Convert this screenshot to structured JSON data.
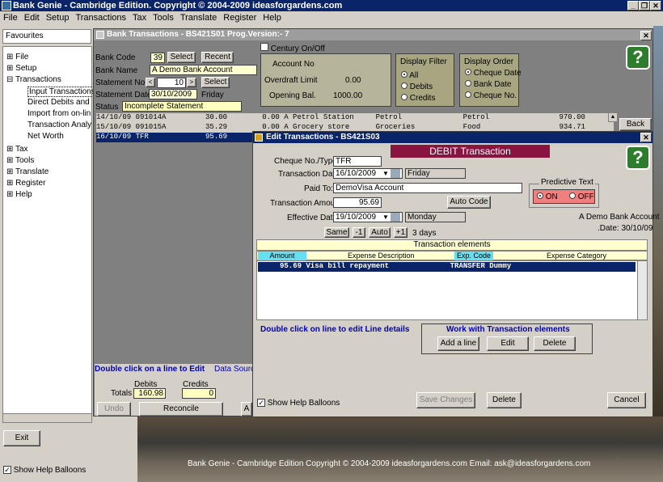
{
  "app": {
    "title": "Bank Genie  - Cambridge Edition. Copyright © 2004-2009 ideasforgardens.com",
    "menu": [
      "File",
      "Edit",
      "Setup",
      "Transactions",
      "Tax",
      "Tools",
      "Translate",
      "Register",
      "Help"
    ],
    "footer": "Bank Genie - Cambridge Edition     Copyright © 2004-2009 ideasforgardens.com     Email:  ask@ideasforgardens.com"
  },
  "left": {
    "favourites": "Favourites",
    "tree": [
      {
        "label": "File",
        "kind": "plus"
      },
      {
        "label": "Setup",
        "kind": "plus"
      },
      {
        "label": "Transactions",
        "kind": "minus"
      },
      {
        "label": "Input Transactions",
        "kind": "child"
      },
      {
        "label": "Direct Debits and",
        "kind": "child"
      },
      {
        "label": "Import from on-lin",
        "kind": "child"
      },
      {
        "label": "Transaction Analy",
        "kind": "child"
      },
      {
        "label": "Net Worth",
        "kind": "child"
      },
      {
        "label": "Tax",
        "kind": "plus"
      },
      {
        "label": "Tools",
        "kind": "plus"
      },
      {
        "label": "Translate",
        "kind": "plus"
      },
      {
        "label": "Register",
        "kind": "plus"
      },
      {
        "label": "Help",
        "kind": "plus"
      }
    ],
    "exit": "Exit",
    "show_help": "Show Help Balloons"
  },
  "bt": {
    "title": "Bank Transactions - BS421S01   Prog.Version:-  7",
    "century": "Century On/Off",
    "bank_code_label": "Bank Code",
    "bank_code": "39",
    "select": "Select",
    "recent": "Recent",
    "bank_name_label": "Bank Name",
    "bank_name": "A Demo Bank Account",
    "stmt_no_label": "Statement No",
    "stmt_no": "10",
    "stmt_select": "Select",
    "stmt_date_label": "Statement Date",
    "stmt_date": "30/10/2009",
    "stmt_day": "Friday",
    "status_label": "Status",
    "status": "Incomplete Statement",
    "account_no": "Account No",
    "overdraft_label": "Overdraft Limit",
    "overdraft": "0.00",
    "opening_label": "Opening Bal.",
    "opening": "1000.00",
    "filter_title": "Display Filter",
    "filter": [
      "All",
      "Debits",
      "Credits"
    ],
    "order_title": "Display Order",
    "order": [
      "Cheque Date",
      "Bank Date",
      "Cheque No."
    ],
    "rows": [
      "14/10/09 091014A         30.00        0.00 A Petrol Station     Petrol              Petrol                970.00",
      "15/10/09 091015A         35.29        0.00 A Grocery store      Groceries           Food                  934.71",
      "16/10/09 TFR             95.69"
    ],
    "back": "Back",
    "dbl_click": "Double click on a line to Edit",
    "data_source": "Data Source",
    "debits_label": "Debits",
    "credits_label": "Credits",
    "totals_label": "Totals",
    "debits": "160.98",
    "credits": "0",
    "undo": "Undo",
    "reconcile": "Reconcile",
    "a_btn": "A"
  },
  "et": {
    "title": "Edit Transactions - BS421S03",
    "banner": "DEBIT Transaction",
    "cheque_label": "Cheque No./Type",
    "cheque": "TFR",
    "tdate_label": "Transaction Date",
    "tdate": "16/10/2009",
    "tday": "Friday",
    "paid_label": "Paid To:",
    "paid": "DemoVisa Account",
    "amount_label": "Transaction Amount",
    "amount": "95.69",
    "auto_code": "Auto Code",
    "edate_label": "Effective Date",
    "edate": "19/10/2009",
    "eday": "Monday",
    "same": "Same",
    "minus1": "-1",
    "auto": "Auto",
    "plus1": "+1",
    "days": "3 days",
    "predictive": "Predictive Text",
    "on": "ON",
    "off": "OFF",
    "bank_acc": "A Demo Bank Account",
    "bank_date": ".Date: 30/10/09",
    "elements_title": "Transaction elements",
    "cols": [
      "Amount",
      "Expense Description",
      "Exp. Code",
      "Expense Category"
    ],
    "line": "     95.69 Visa bill repayment              TRANSFER Dummy",
    "dbl_line": "Double click on line to edit Line details",
    "work_title": "Work with Transaction elements",
    "add_line": "Add a line",
    "edit": "Edit",
    "delete": "Delete",
    "show_help": "Show Help Balloons",
    "save": "Save Changes",
    "delete2": "Delete",
    "cancel": "Cancel"
  }
}
